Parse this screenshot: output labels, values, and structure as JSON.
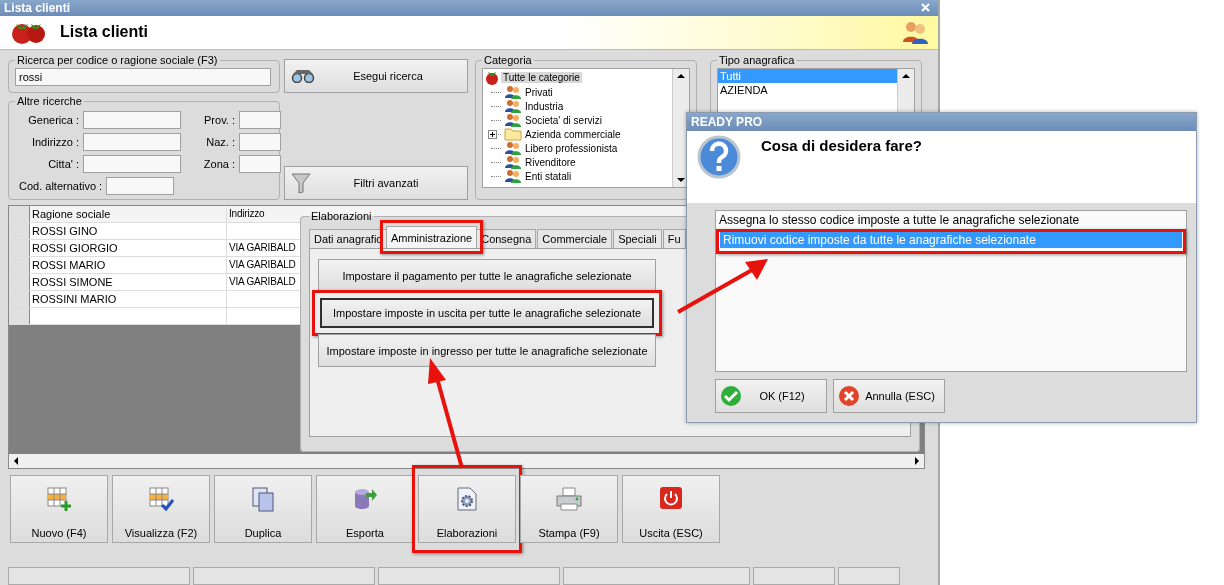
{
  "window": {
    "title": "Lista clienti",
    "header_title": "Lista clienti"
  },
  "search": {
    "legend": "Ricerca per codice o ragione sociale (F3)",
    "value": "rossi",
    "button": "Esegui ricerca"
  },
  "other_search": {
    "legend": "Altre ricerche",
    "rows": [
      {
        "left": "Generica :",
        "right": "Prov. :"
      },
      {
        "left": "Indirizzo :",
        "right": "Naz. :"
      },
      {
        "left": "Citta' :",
        "right": "Zona :"
      },
      {
        "left": "Cod. alternativo :"
      }
    ]
  },
  "filter_button": "Filtri avanzati",
  "category": {
    "legend": "Categoria",
    "root": {
      "label": "Tutte le categorie",
      "selected": true
    },
    "items": [
      {
        "label": "Privati",
        "kind": "group"
      },
      {
        "label": "Industria",
        "kind": "group"
      },
      {
        "label": "Societa' di servizi",
        "kind": "group"
      },
      {
        "label": "Azienda commerciale",
        "kind": "folder"
      },
      {
        "label": "Libero professionista",
        "kind": "group"
      },
      {
        "label": "Rivenditore",
        "kind": "group"
      },
      {
        "label": "Enti statali",
        "kind": "group"
      }
    ]
  },
  "record_type": {
    "legend": "Tipo anagrafica",
    "items": [
      {
        "label": "Tutti",
        "selected": true
      },
      {
        "label": "AZIENDA",
        "selected": false
      }
    ]
  },
  "table": {
    "columns": [
      "Ragione sociale",
      "Indirizzo"
    ],
    "rows": [
      [
        "ROSSI GINO",
        null
      ],
      [
        "ROSSI GIORGIO",
        "VIA GARIBALD"
      ],
      [
        "ROSSI MARIO",
        "VIA GARIBALD"
      ],
      [
        "ROSSI SIMONE",
        "VIA GARIBALD"
      ],
      [
        "ROSSINI MARIO",
        null
      ]
    ]
  },
  "processing": {
    "legend": "Elaborazioni",
    "tabs": [
      {
        "label": "Dati anagrafic",
        "selected": false,
        "highlighted": false
      },
      {
        "label": "Amministrazione",
        "selected": true,
        "highlighted": true
      },
      {
        "label": "Consegna",
        "selected": false,
        "highlighted": false
      },
      {
        "label": "Commerciale",
        "selected": false,
        "highlighted": false
      },
      {
        "label": "Speciali",
        "selected": false,
        "highlighted": false
      },
      {
        "label": "Fu",
        "selected": false,
        "highlighted": false
      }
    ],
    "buttons": [
      {
        "label": "Impostare il pagamento per tutte le anagrafiche selezionate",
        "focused": false,
        "highlighted": false
      },
      {
        "label": "Impostare imposte in uscita per tutte le anagrafiche selezionate",
        "focused": true,
        "highlighted": true
      },
      {
        "label": "Impostare imposte in ingresso per tutte le anagrafiche selezionate",
        "focused": false,
        "highlighted": false
      }
    ]
  },
  "toolbar": [
    {
      "label": "Nuovo (F4)",
      "kind": "new",
      "highlighted": false
    },
    {
      "label": "Visualizza (F2)",
      "kind": "view",
      "highlighted": false
    },
    {
      "label": "Duplica",
      "kind": "duplicate",
      "highlighted": false
    },
    {
      "label": "Esporta",
      "kind": "export",
      "highlighted": false
    },
    {
      "label": "Elaborazioni",
      "kind": "process",
      "highlighted": true
    },
    {
      "label": "Stampa (F9)",
      "kind": "print",
      "highlighted": false
    },
    {
      "label": "Uscita (ESC)",
      "kind": "exit",
      "highlighted": false
    }
  ],
  "dialog": {
    "title": "READY PRO",
    "question": "Cosa di desidera fare?",
    "options": [
      {
        "label": "Assegna lo stesso codice imposte a tutte le anagrafiche selezionate",
        "selected": false,
        "highlighted": false
      },
      {
        "label": "Rimuovi codice imposte da tutte le anagrafiche selezionate",
        "selected": true,
        "highlighted": true
      }
    ],
    "buttons": [
      {
        "label": "OK (F12)",
        "kind": "ok"
      },
      {
        "label": "Annulla (ESC)",
        "kind": "cancel"
      }
    ]
  }
}
